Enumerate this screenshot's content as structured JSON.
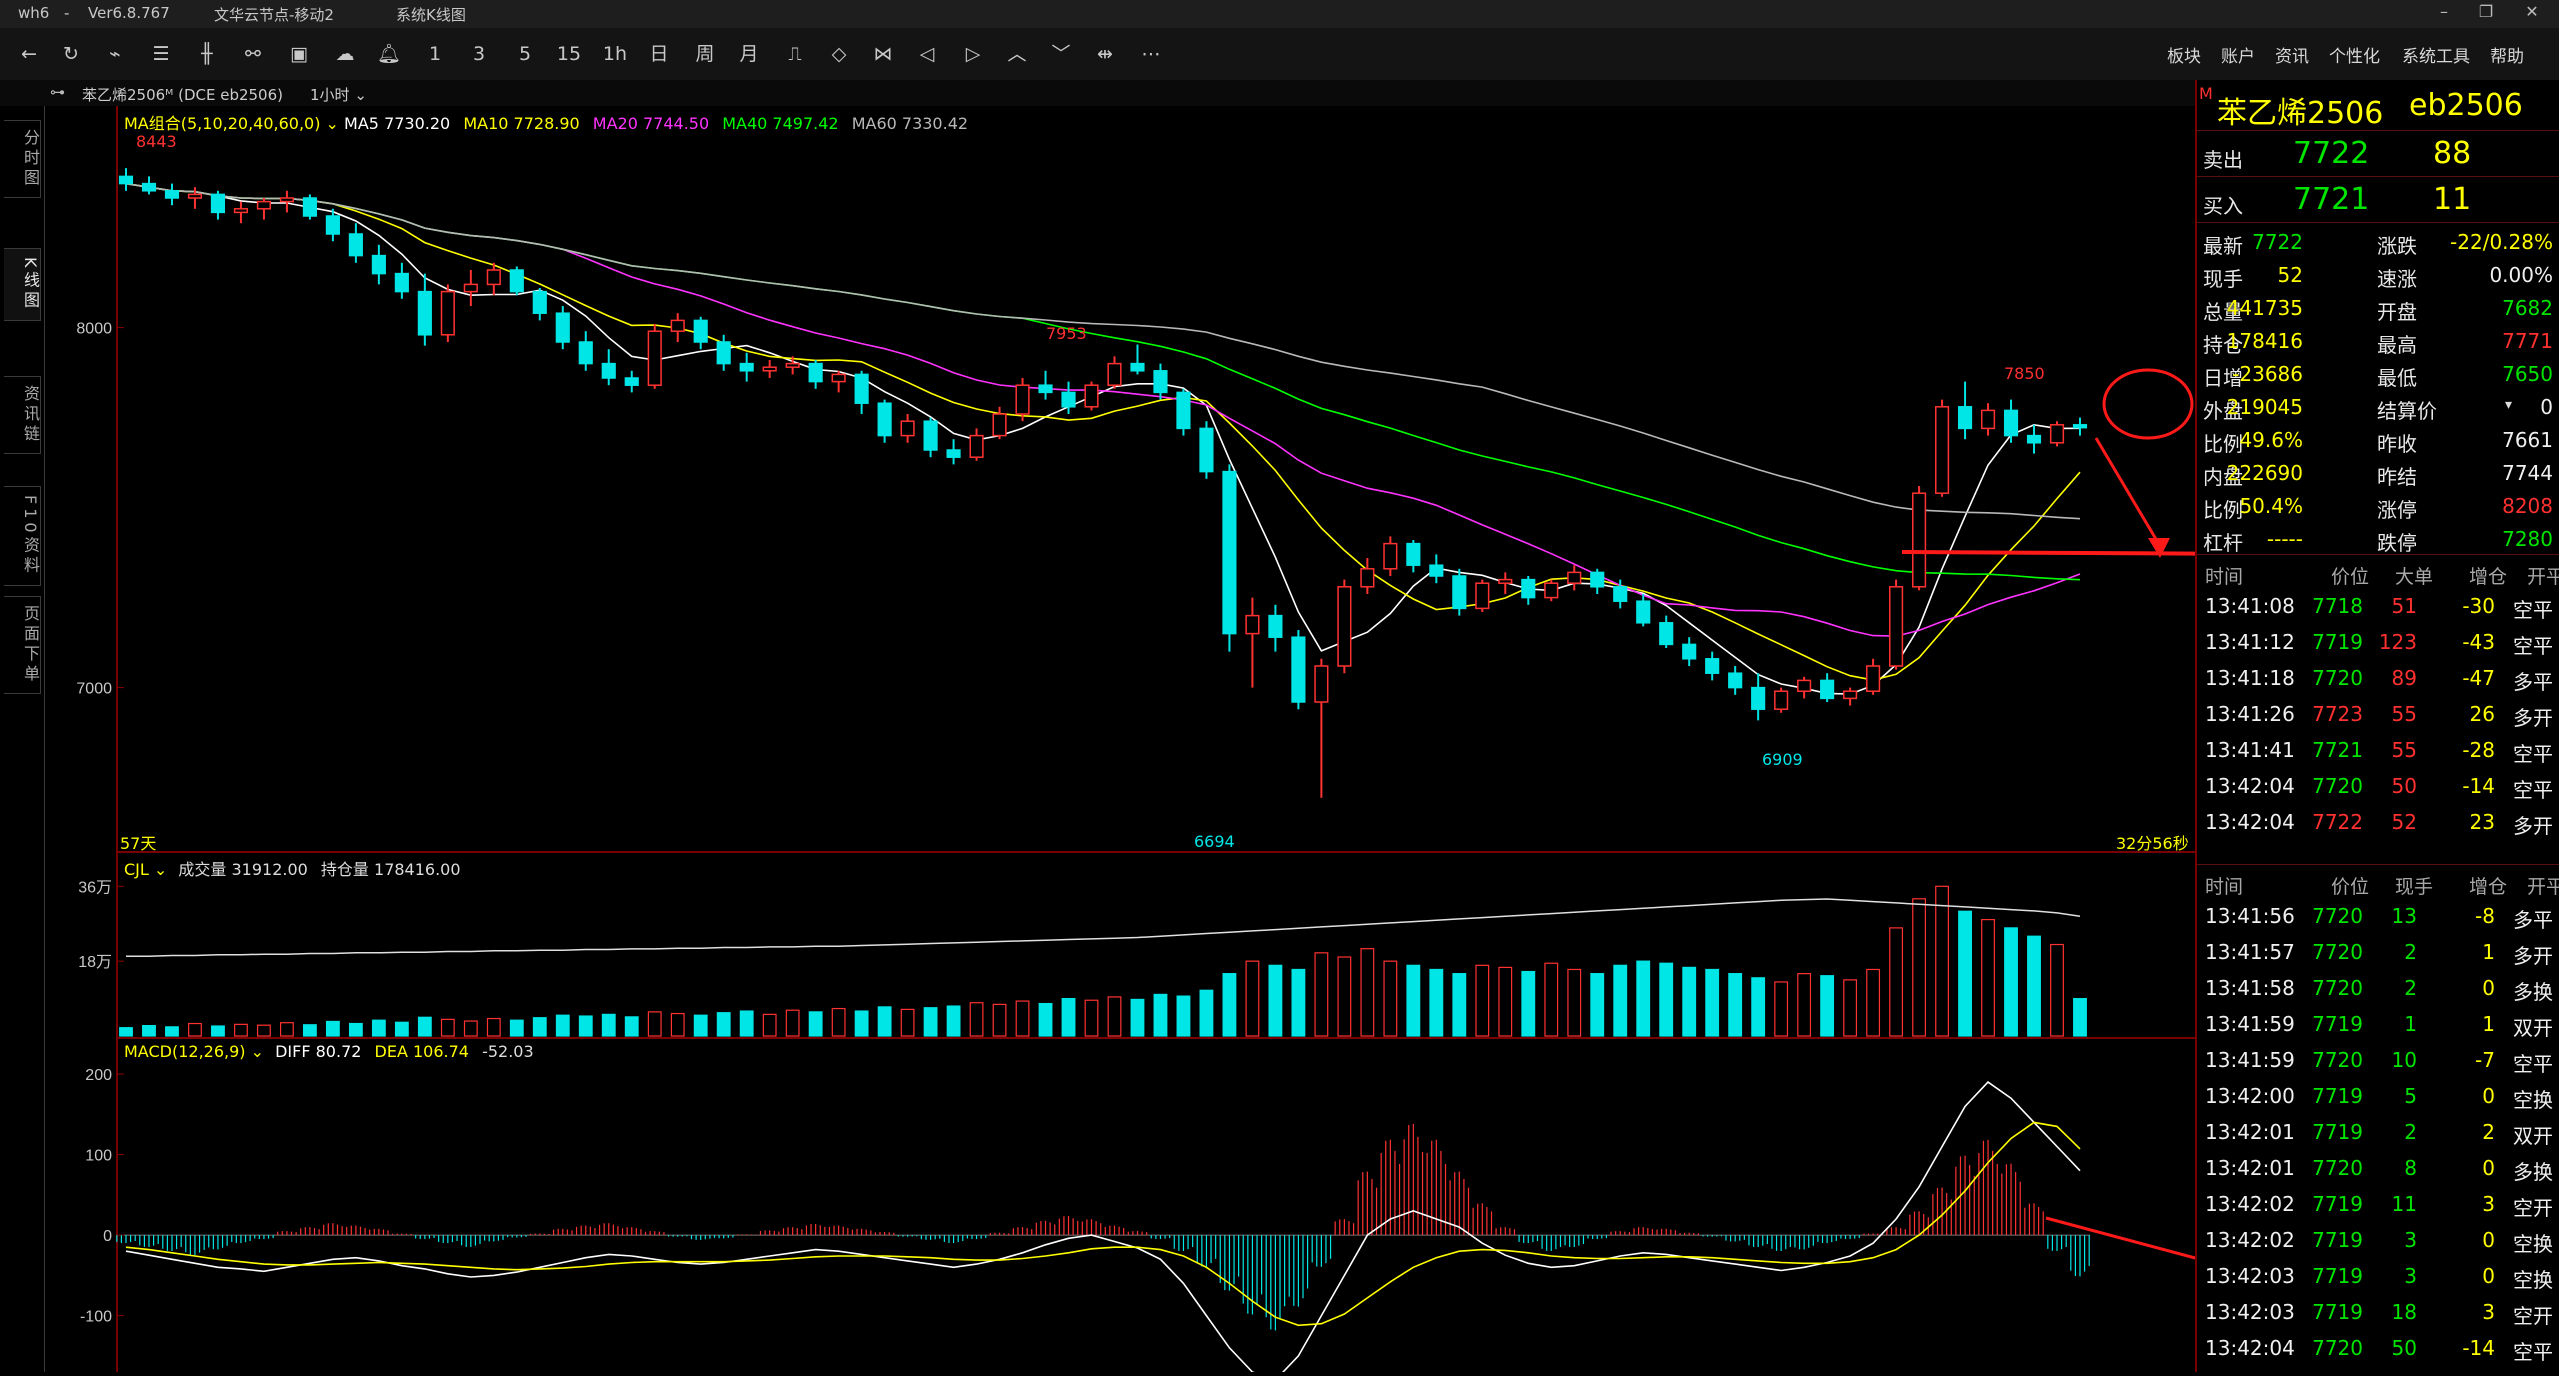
{
  "window": {
    "app": "wh6",
    "version": "Ver6.8.767",
    "server": "文华云节点-移动2",
    "view": "系统K线图"
  },
  "toolbar": {
    "periods": [
      "1",
      "3",
      "5",
      "15",
      "1h",
      "日",
      "周",
      "月"
    ],
    "menus": [
      "板块",
      "账户",
      "资讯",
      "个性化",
      "系统工具",
      "帮助"
    ]
  },
  "contract": {
    "header": "苯乙烯2506ᴹ  (DCE  eb2506)",
    "period_label": "1小时",
    "title_name": "苯乙烯2506",
    "title_code": "eb2506",
    "flag": "M"
  },
  "sidebar": {
    "tabs": [
      "分时图",
      "K线图",
      "资讯链",
      "F10资料",
      "页面下单"
    ]
  },
  "ma_legend": {
    "group": "MA组合(5,10,20,40,60,0)",
    "ma5": "MA5 7730.20",
    "ma10": "MA10 7728.90",
    "ma20": "MA20 7744.50",
    "ma40": "MA40 7497.42",
    "ma60": "MA60 7330.42",
    "colors": {
      "ma5": "#ffffff",
      "ma10": "#ffff00",
      "ma20": "#ff33ff",
      "ma40": "#00ff00",
      "ma60": "#b8b8b8"
    }
  },
  "chart_labels": {
    "days": "57天",
    "countdown": "32分56秒",
    "high_1": "8443",
    "high_2": "7953",
    "high_3": "7850",
    "low_1": "6694",
    "low_2": "6909"
  },
  "vol_legend": {
    "name": "CJL",
    "volume": "成交量 31912.00",
    "oi": "持仓量 178416.00",
    "ticks": [
      "36万",
      "18万"
    ]
  },
  "macd_legend": {
    "name": "MACD(12,26,9)",
    "diff": "DIFF 80.72",
    "dea": "DEA 106.74",
    "macd": "-52.03",
    "ticks": [
      "200",
      "100",
      "0",
      "-100"
    ]
  },
  "chart_data": {
    "type": "candlestick",
    "price_ticks": [
      8000,
      7000
    ],
    "ylim": [
      6560,
      8560
    ],
    "candles": [
      [
        8420,
        8443,
        8380,
        8400
      ],
      [
        8400,
        8420,
        8370,
        8380
      ],
      [
        8380,
        8400,
        8340,
        8360
      ],
      [
        8360,
        8390,
        8330,
        8370
      ],
      [
        8370,
        8380,
        8300,
        8320
      ],
      [
        8320,
        8350,
        8290,
        8330
      ],
      [
        8330,
        8360,
        8300,
        8350
      ],
      [
        8350,
        8380,
        8320,
        8360
      ],
      [
        8360,
        8370,
        8300,
        8310
      ],
      [
        8310,
        8330,
        8240,
        8260
      ],
      [
        8260,
        8290,
        8180,
        8200
      ],
      [
        8200,
        8230,
        8120,
        8150
      ],
      [
        8150,
        8180,
        8080,
        8100
      ],
      [
        8100,
        8150,
        7950,
        7980
      ],
      [
        7980,
        8120,
        7960,
        8100
      ],
      [
        8100,
        8160,
        8060,
        8120
      ],
      [
        8120,
        8180,
        8090,
        8160
      ],
      [
        8160,
        8170,
        8090,
        8100
      ],
      [
        8100,
        8110,
        8020,
        8040
      ],
      [
        8040,
        8060,
        7940,
        7960
      ],
      [
        7960,
        7990,
        7880,
        7900
      ],
      [
        7900,
        7940,
        7840,
        7860
      ],
      [
        7860,
        7880,
        7820,
        7840
      ],
      [
        7840,
        8010,
        7830,
        7990
      ],
      [
        7990,
        8040,
        7960,
        8020
      ],
      [
        8020,
        8030,
        7940,
        7960
      ],
      [
        7960,
        7980,
        7880,
        7900
      ],
      [
        7900,
        7930,
        7850,
        7880
      ],
      [
        7880,
        7910,
        7860,
        7890
      ],
      [
        7890,
        7920,
        7870,
        7900
      ],
      [
        7900,
        7910,
        7830,
        7850
      ],
      [
        7850,
        7880,
        7820,
        7870
      ],
      [
        7870,
        7880,
        7760,
        7790
      ],
      [
        7790,
        7800,
        7680,
        7700
      ],
      [
        7700,
        7760,
        7680,
        7740
      ],
      [
        7740,
        7750,
        7640,
        7660
      ],
      [
        7660,
        7690,
        7620,
        7640
      ],
      [
        7640,
        7720,
        7630,
        7700
      ],
      [
        7700,
        7780,
        7690,
        7760
      ],
      [
        7760,
        7860,
        7740,
        7840
      ],
      [
        7840,
        7880,
        7800,
        7820
      ],
      [
        7820,
        7850,
        7760,
        7780
      ],
      [
        7780,
        7850,
        7770,
        7840
      ],
      [
        7840,
        7920,
        7830,
        7900
      ],
      [
        7900,
        7953,
        7870,
        7880
      ],
      [
        7880,
        7900,
        7800,
        7820
      ],
      [
        7820,
        7830,
        7700,
        7720
      ],
      [
        7720,
        7740,
        7580,
        7600
      ],
      [
        7600,
        7620,
        7100,
        7150
      ],
      [
        7150,
        7250,
        7000,
        7200
      ],
      [
        7200,
        7230,
        7100,
        7140
      ],
      [
        7140,
        7160,
        6940,
        6960
      ],
      [
        6960,
        7080,
        6694,
        7060
      ],
      [
        7060,
        7300,
        7040,
        7280
      ],
      [
        7280,
        7360,
        7260,
        7330
      ],
      [
        7330,
        7420,
        7310,
        7400
      ],
      [
        7400,
        7410,
        7320,
        7340
      ],
      [
        7340,
        7370,
        7290,
        7310
      ],
      [
        7310,
        7330,
        7200,
        7220
      ],
      [
        7220,
        7300,
        7210,
        7290
      ],
      [
        7290,
        7320,
        7260,
        7300
      ],
      [
        7300,
        7310,
        7230,
        7250
      ],
      [
        7250,
        7300,
        7240,
        7290
      ],
      [
        7290,
        7340,
        7270,
        7320
      ],
      [
        7320,
        7330,
        7260,
        7280
      ],
      [
        7280,
        7300,
        7220,
        7240
      ],
      [
        7240,
        7260,
        7170,
        7180
      ],
      [
        7180,
        7200,
        7110,
        7120
      ],
      [
        7120,
        7140,
        7060,
        7080
      ],
      [
        7080,
        7100,
        7020,
        7040
      ],
      [
        7040,
        7060,
        6980,
        7000
      ],
      [
        7000,
        7040,
        6909,
        6940
      ],
      [
        6940,
        7000,
        6930,
        6990
      ],
      [
        6990,
        7030,
        6970,
        7020
      ],
      [
        7020,
        7040,
        6960,
        6970
      ],
      [
        6970,
        7000,
        6950,
        6990
      ],
      [
        6990,
        7080,
        6980,
        7060
      ],
      [
        7060,
        7300,
        7050,
        7280
      ],
      [
        7280,
        7560,
        7270,
        7540
      ],
      [
        7540,
        7800,
        7530,
        7780
      ],
      [
        7780,
        7850,
        7690,
        7720
      ],
      [
        7720,
        7790,
        7700,
        7770
      ],
      [
        7770,
        7800,
        7680,
        7700
      ],
      [
        7700,
        7730,
        7650,
        7680
      ],
      [
        7680,
        7740,
        7670,
        7730
      ],
      [
        7730,
        7750,
        7700,
        7722
      ]
    ],
    "volume_ticks": [
      360000,
      180000
    ],
    "volume_k": [
      20,
      25,
      22,
      30,
      24,
      28,
      26,
      32,
      27,
      35,
      30,
      38,
      33,
      45,
      40,
      36,
      42,
      38,
      44,
      50,
      48,
      52,
      46,
      58,
      54,
      50,
      56,
      60,
      52,
      62,
      58,
      66,
      60,
      70,
      64,
      68,
      72,
      80,
      76,
      84,
      78,
      90,
      86,
      94,
      88,
      100,
      96,
      110,
      150,
      180,
      170,
      160,
      200,
      190,
      210,
      180,
      170,
      160,
      150,
      170,
      165,
      155,
      175,
      160,
      150,
      170,
      180,
      175,
      165,
      160,
      150,
      140,
      130,
      150,
      145,
      135,
      160,
      260,
      330,
      360,
      300,
      280,
      260,
      240,
      220,
      90
    ],
    "oi_k": [
      120,
      120,
      121,
      121,
      122,
      122,
      123,
      123,
      124,
      124,
      125,
      125,
      126,
      126,
      127,
      127,
      128,
      128,
      129,
      129,
      130,
      130,
      131,
      131,
      132,
      132,
      133,
      133,
      134,
      134,
      135,
      135,
      136,
      137,
      138,
      139,
      140,
      141,
      142,
      143,
      144,
      145,
      146,
      147,
      148,
      150,
      152,
      154,
      156,
      158,
      160,
      162,
      164,
      166,
      168,
      170,
      172,
      174,
      176,
      178,
      180,
      182,
      184,
      186,
      188,
      190,
      192,
      194,
      196,
      198,
      200,
      202,
      204,
      205,
      206,
      204,
      202,
      200,
      198,
      196,
      194,
      192,
      190,
      188,
      185,
      180
    ],
    "macd_ticks": [
      200,
      100,
      0,
      -100
    ],
    "macd_ylim": [
      -170,
      210
    ],
    "macd_hist": [
      -10,
      -15,
      -20,
      -25,
      -18,
      -10,
      -5,
      5,
      10,
      15,
      12,
      8,
      2,
      -5,
      -10,
      -15,
      -8,
      -3,
      2,
      8,
      12,
      15,
      10,
      5,
      -2,
      -6,
      -4,
      1,
      6,
      10,
      14,
      12,
      8,
      4,
      -2,
      -6,
      -10,
      -5,
      3,
      10,
      18,
      24,
      20,
      12,
      5,
      -5,
      -20,
      -40,
      -70,
      -100,
      -120,
      -90,
      -40,
      20,
      80,
      120,
      140,
      120,
      80,
      40,
      10,
      -10,
      -20,
      -15,
      -5,
      5,
      10,
      8,
      3,
      -2,
      -8,
      -15,
      -20,
      -18,
      -10,
      -5,
      2,
      10,
      30,
      60,
      100,
      120,
      90,
      40,
      -20,
      -52
    ],
    "macd_diff": [
      -20,
      -25,
      -30,
      -35,
      -40,
      -42,
      -45,
      -40,
      -35,
      -30,
      -28,
      -32,
      -38,
      -42,
      -48,
      -52,
      -50,
      -46,
      -40,
      -34,
      -28,
      -24,
      -26,
      -30,
      -34,
      -36,
      -34,
      -30,
      -26,
      -22,
      -18,
      -20,
      -24,
      -28,
      -32,
      -36,
      -40,
      -36,
      -30,
      -22,
      -12,
      -4,
      0,
      -8,
      -16,
      -30,
      -60,
      -100,
      -140,
      -170,
      -180,
      -150,
      -100,
      -50,
      0,
      20,
      30,
      20,
      10,
      -10,
      -25,
      -35,
      -40,
      -38,
      -32,
      -26,
      -22,
      -24,
      -28,
      -32,
      -36,
      -40,
      -44,
      -40,
      -34,
      -26,
      -10,
      20,
      60,
      110,
      160,
      190,
      170,
      140,
      110,
      80
    ],
    "macd_dea": [
      -15,
      -18,
      -22,
      -26,
      -30,
      -33,
      -36,
      -37,
      -37,
      -36,
      -35,
      -34,
      -35,
      -36,
      -38,
      -40,
      -42,
      -43,
      -42,
      -41,
      -39,
      -36,
      -34,
      -33,
      -33,
      -33,
      -33,
      -32,
      -31,
      -29,
      -27,
      -26,
      -26,
      -26,
      -27,
      -28,
      -30,
      -31,
      -31,
      -29,
      -26,
      -22,
      -17,
      -15,
      -15,
      -18,
      -26,
      -40,
      -60,
      -82,
      -102,
      -112,
      -110,
      -98,
      -78,
      -58,
      -40,
      -28,
      -20,
      -18,
      -19,
      -22,
      -26,
      -28,
      -29,
      -29,
      -28,
      -27,
      -27,
      -28,
      -30,
      -32,
      -34,
      -35,
      -35,
      -33,
      -28,
      -18,
      0,
      25,
      55,
      90,
      120,
      140,
      135,
      107
    ]
  },
  "quote": {
    "sell_label": "卖出",
    "sell_price": "7722",
    "sell_vol": "88",
    "buy_label": "买入",
    "buy_price": "7721",
    "buy_vol": "11",
    "rows": [
      [
        "最新",
        "7722",
        "涨跌",
        "-22/0.28%"
      ],
      [
        "现手",
        "52",
        "速涨",
        "0.00%"
      ],
      [
        "总量",
        "441735",
        "开盘",
        "7682"
      ],
      [
        "持仓",
        "178416",
        "最高",
        "7771"
      ],
      [
        "日增",
        "-23686",
        "最低",
        "7650"
      ],
      [
        "外盘",
        "219045",
        "结算价",
        "0"
      ],
      [
        "比例",
        "49.6%",
        "昨收",
        "7661"
      ],
      [
        "内盘",
        "222690",
        "昨结",
        "7744"
      ],
      [
        "比例",
        "50.4%",
        "涨停",
        "8208"
      ],
      [
        "杠杆",
        "-----",
        "跌停",
        "7280"
      ]
    ]
  },
  "ticks_big": {
    "headers": [
      "时间",
      "价位",
      "大单",
      "增仓",
      "开平"
    ],
    "rows": [
      [
        "13:41:08",
        "7718",
        "51",
        "-30",
        "空平"
      ],
      [
        "13:41:12",
        "7719",
        "123",
        "-43",
        "空平"
      ],
      [
        "13:41:18",
        "7720",
        "89",
        "-47",
        "多平"
      ],
      [
        "13:41:26",
        "7723",
        "55",
        "26",
        "多开"
      ],
      [
        "13:41:41",
        "7721",
        "55",
        "-28",
        "空平"
      ],
      [
        "13:42:04",
        "7720",
        "50",
        "-14",
        "空平"
      ],
      [
        "13:42:04",
        "7722",
        "52",
        "23",
        "多开"
      ]
    ]
  },
  "ticks": {
    "headers": [
      "时间",
      "价位",
      "现手",
      "增仓",
      "开平"
    ],
    "rows": [
      [
        "13:41:56",
        "7720",
        "13",
        "-8",
        "多平"
      ],
      [
        "13:41:57",
        "7720",
        "2",
        "1",
        "多开"
      ],
      [
        "13:41:58",
        "7720",
        "2",
        "0",
        "多换"
      ],
      [
        "13:41:59",
        "7719",
        "1",
        "1",
        "双开"
      ],
      [
        "13:41:59",
        "7720",
        "10",
        "-7",
        "空平"
      ],
      [
        "13:42:00",
        "7719",
        "5",
        "0",
        "空换"
      ],
      [
        "13:42:01",
        "7719",
        "2",
        "2",
        "双开"
      ],
      [
        "13:42:01",
        "7720",
        "8",
        "0",
        "多换"
      ],
      [
        "13:42:02",
        "7719",
        "11",
        "3",
        "空开"
      ],
      [
        "13:42:02",
        "7719",
        "3",
        "0",
        "空换"
      ],
      [
        "13:42:03",
        "7719",
        "3",
        "0",
        "空换"
      ],
      [
        "13:42:03",
        "7719",
        "18",
        "3",
        "空开"
      ],
      [
        "13:42:04",
        "7720",
        "50",
        "-14",
        "空平"
      ]
    ]
  }
}
